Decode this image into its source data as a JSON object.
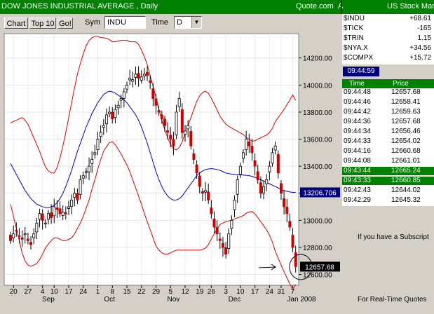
{
  "window": {
    "title": "DOW JONES INDUSTRIAL AVERAGE , Daily",
    "source": "Quote.com",
    "source_suffix": "A",
    "panel_title": "US Stock Mar"
  },
  "toolbar": {
    "chart_label": "Chart",
    "top10_label": "Top 10",
    "go_label": "Go!",
    "sym_label": "Sym",
    "sym_value": "INDU",
    "time_label": "Time",
    "time_value": "D",
    "time_arrow": "▼"
  },
  "quotes": [
    {
      "symbol": "$INDU",
      "change": "+68.61"
    },
    {
      "symbol": "$TICK",
      "change": "-165"
    },
    {
      "symbol": "$TRIN",
      "change": "1.15"
    },
    {
      "symbol": "$NYA.X",
      "change": "+34.56"
    },
    {
      "symbol": "$COMPX",
      "change": "+15.72"
    }
  ],
  "clock": "09:44:59",
  "time_sales": {
    "header_time": "Time",
    "header_price": "Price",
    "rows": [
      {
        "time": "09:44:48",
        "price": "12657.68",
        "highlight": false
      },
      {
        "time": "09:44:46",
        "price": "12658.41",
        "highlight": false
      },
      {
        "time": "09:44:42",
        "price": "12659.63",
        "highlight": false
      },
      {
        "time": "09:44:36",
        "price": "12657.68",
        "highlight": false
      },
      {
        "time": "09:44:34",
        "price": "12656.46",
        "highlight": false
      },
      {
        "time": "09:44:33",
        "price": "12654.02",
        "highlight": false
      },
      {
        "time": "09:44:16",
        "price": "12660.68",
        "highlight": false
      },
      {
        "time": "09:44:08",
        "price": "12661.01",
        "highlight": false
      },
      {
        "time": "09:43:44",
        "price": "12665.24",
        "highlight": true
      },
      {
        "time": "09:43:33",
        "price": "12660.85",
        "highlight": true
      },
      {
        "time": "09:42:43",
        "price": "12644.02",
        "highlight": false
      },
      {
        "time": "09:42:29",
        "price": "12645.32",
        "highlight": false
      }
    ]
  },
  "promo": {
    "line1": "If you have a Subscript",
    "line2": "For Real-Time Quotes"
  },
  "colors": {
    "title_bg": "#008000",
    "candle_down": "#cc0000",
    "candle_up": "#ffffff",
    "bollinger": "#e00000",
    "moving_average": "#0000cc",
    "last_price_box": "#000000",
    "ma_price_box": "#00007b"
  },
  "chart_data": {
    "type": "candlestick",
    "title": "DOW JONES INDUSTRIAL AVERAGE , Daily",
    "ylim": [
      12520,
      14380
    ],
    "y_ticks": [
      12600,
      12800,
      13000,
      13200,
      13400,
      13600,
      13800,
      14000,
      14200
    ],
    "y_tick_labels": [
      "12600.00",
      "12800.00",
      "13000.00",
      "13200.00",
      "13400.00",
      "13600.00",
      "13800.00",
      "14000.00",
      "14200.00"
    ],
    "x_tick_labels": [
      "20",
      "27",
      "4",
      "10",
      "17",
      "24",
      "1",
      "8",
      "15",
      "22",
      "29",
      "5",
      "12",
      "19",
      "26",
      "3",
      "10",
      "17",
      "24",
      "31",
      "7"
    ],
    "x_tick_index": [
      1,
      6,
      11,
      15,
      20,
      25,
      30,
      35,
      40,
      45,
      50,
      55,
      60,
      65,
      69,
      74,
      79,
      84,
      89,
      93,
      97
    ],
    "month_labels": [
      "Sep",
      "Oct",
      "Nov",
      "Dec",
      "Jan 2008"
    ],
    "month_index": [
      13,
      34,
      56,
      77,
      100
    ],
    "last_price": "12657.68",
    "ma_price": "13206.706",
    "grid": true,
    "close": [
      12850,
      12900,
      12920,
      12880,
      12860,
      12900,
      12850,
      12820,
      12900,
      12980,
      13050,
      13000,
      12980,
      13050,
      13020,
      13100,
      13080,
      13050,
      13060,
      13050,
      13100,
      13150,
      13200,
      13150,
      13300,
      13330,
      13360,
      13400,
      13450,
      13500,
      13600,
      13650,
      13700,
      13780,
      13800,
      13750,
      13820,
      13850,
      13900,
      13950,
      14000,
      14050,
      14040,
      14080,
      14050,
      14060,
      14080,
      14070,
      14020,
      13900,
      13850,
      13800,
      13750,
      13700,
      13650,
      13600,
      13550,
      13800,
      13900,
      13650,
      13660,
      13700,
      13550,
      13450,
      13350,
      13250,
      13200,
      13220,
      13150,
      13050,
      12950,
      12900,
      12850,
      12800,
      12750,
      12900,
      13000,
      13150,
      13300,
      13400,
      13500,
      13600,
      13550,
      13500,
      13400,
      13300,
      13200,
      13250,
      13300,
      13400,
      13500,
      13550,
      13350,
      13200,
      13100,
      13050,
      12950,
      12800,
      12657.68
    ],
    "ma": [
      13420,
      13380,
      13340,
      13300,
      13260,
      13220,
      13190,
      13160,
      13140,
      13120,
      13110,
      13100,
      13095,
      13095,
      13100,
      13110,
      13130,
      13160,
      13200,
      13250,
      13310,
      13370,
      13440,
      13510,
      13570,
      13630,
      13690,
      13740,
      13790,
      13830,
      13870,
      13900,
      13930,
      13945,
      13955,
      13950,
      13940,
      13925,
      13910,
      13890,
      13870,
      13840,
      13810,
      13780,
      13740,
      13690,
      13630,
      13570,
      13500,
      13430,
      13360,
      13300,
      13250,
      13210,
      13180,
      13160,
      13150,
      13150,
      13160,
      13180,
      13210,
      13240,
      13270,
      13300,
      13330,
      13350,
      13365,
      13375,
      13380,
      13382,
      13380,
      13375,
      13370,
      13360,
      13350,
      13345,
      13342,
      13340,
      13338,
      13336,
      13335,
      13333,
      13330,
      13325,
      13318,
      13310,
      13300,
      13290,
      13280,
      13270,
      13260,
      13250,
      13240,
      13230,
      13220,
      13215,
      13210,
      13206.706,
      13206.706
    ],
    "band_width": [
      300,
      350,
      400,
      450,
      500,
      520,
      520,
      500,
      470,
      440,
      400,
      350,
      300,
      270,
      250,
      240,
      260,
      300,
      350,
      400,
      450,
      500,
      540,
      570,
      590,
      600,
      600,
      590,
      560,
      530,
      490,
      450,
      420,
      400,
      380,
      370,
      380,
      400,
      420,
      440,
      460,
      480,
      510,
      540,
      560,
      570,
      580,
      580,
      570,
      560,
      550,
      520,
      490,
      460,
      430,
      400,
      380,
      370,
      380,
      400,
      430,
      460,
      490,
      520,
      550,
      570,
      580,
      580,
      560,
      520,
      480,
      440,
      400,
      380,
      360,
      350,
      340,
      330,
      320,
      310,
      300,
      280,
      270,
      260,
      270,
      290,
      310,
      330,
      350,
      380,
      420,
      480,
      520,
      560,
      600,
      640,
      680,
      720,
      680
    ]
  }
}
